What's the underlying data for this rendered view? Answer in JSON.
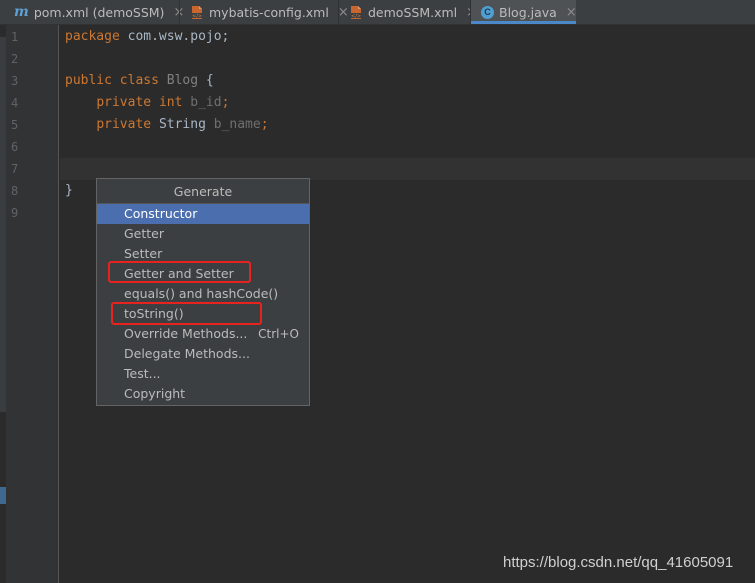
{
  "tabs": [
    {
      "label": "pom.xml (demoSSM)",
      "icon": "maven-m-icon",
      "active": false
    },
    {
      "label": "mybatis-config.xml",
      "icon": "xml-file-icon",
      "active": false
    },
    {
      "label": "demoSSM.xml",
      "icon": "xml-file-icon",
      "active": false
    },
    {
      "label": "Blog.java",
      "icon": "java-class-icon",
      "active": true
    }
  ],
  "tab_close_glyph": "×",
  "editor": {
    "line_numbers": [
      "1",
      "2",
      "3",
      "4",
      "5",
      "6",
      "7",
      "8",
      "9"
    ],
    "code": {
      "line1_kw": "package",
      "line1_rest": " com.wsw.pojo;",
      "line3_kw": "public class",
      "line3_class": "Blog",
      "line3_rest": " {",
      "line4_kw": "private",
      "line4_type_kw": "int",
      "line4_field": "b_id",
      "line5_kw": "private",
      "line5_type": "String",
      "line5_field": "b_name",
      "line8": "}"
    }
  },
  "generate_menu": {
    "title": "Generate",
    "items": [
      {
        "label": "Constructor",
        "shortcut": ""
      },
      {
        "label": "Getter",
        "shortcut": ""
      },
      {
        "label": "Setter",
        "shortcut": ""
      },
      {
        "label": "Getter and Setter",
        "shortcut": ""
      },
      {
        "label": "equals() and hashCode()",
        "shortcut": ""
      },
      {
        "label": "toString()",
        "shortcut": ""
      },
      {
        "label": "Override Methods...",
        "shortcut": "Ctrl+O"
      },
      {
        "label": "Delegate Methods...",
        "shortcut": ""
      },
      {
        "label": "Test...",
        "shortcut": ""
      },
      {
        "label": "Copyright",
        "shortcut": ""
      }
    ],
    "selected_index": 0
  },
  "annotations": {
    "highlight_color": "#e8231f"
  },
  "watermark": "https://blog.csdn.net/qq_41605091"
}
